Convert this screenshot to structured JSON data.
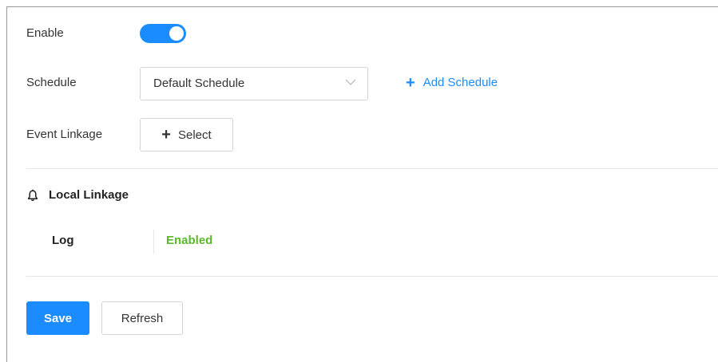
{
  "form": {
    "enable_label": "Enable",
    "enable_state": "on",
    "schedule_label": "Schedule",
    "schedule_value": "Default Schedule",
    "add_schedule_label": "Add Schedule",
    "event_linkage_label": "Event Linkage",
    "select_button_label": "Select"
  },
  "local_linkage": {
    "title": "Local Linkage",
    "icon": "bell-icon",
    "log_label": "Log",
    "log_status": "Enabled"
  },
  "actions": {
    "save_label": "Save",
    "refresh_label": "Refresh"
  },
  "colors": {
    "accent": "#1a8cff",
    "status_enabled": "#5cb82a"
  }
}
